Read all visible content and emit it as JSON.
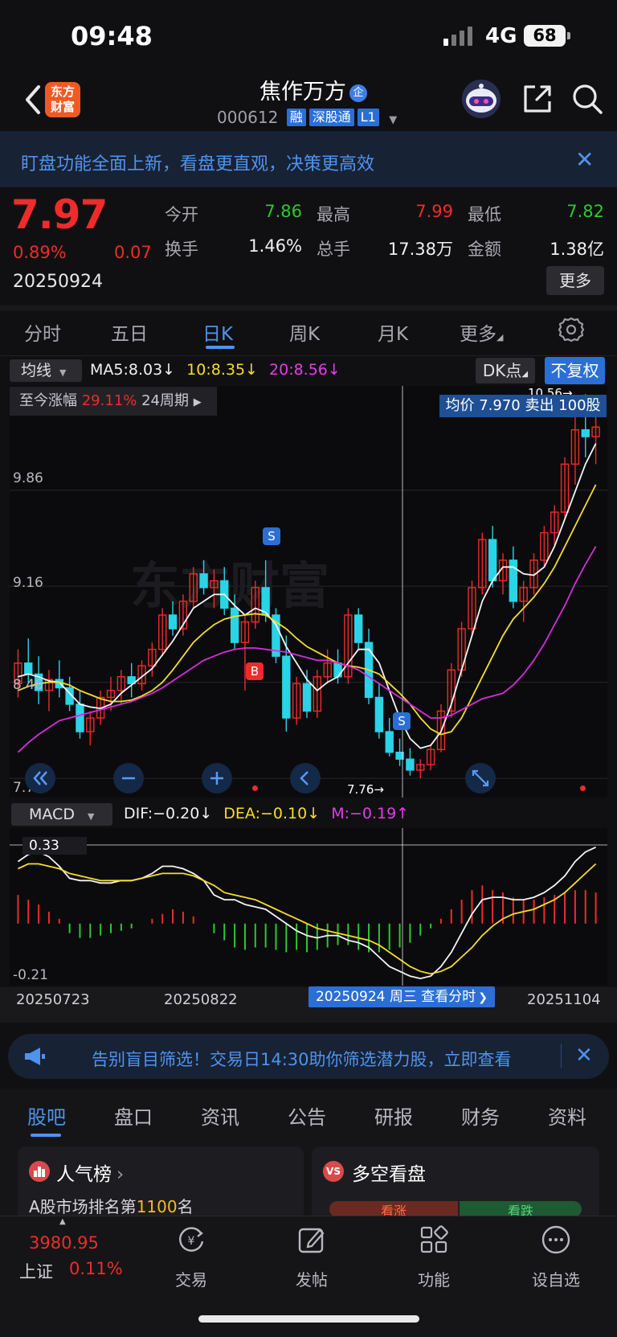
{
  "status_bar": {
    "time": "09:48",
    "network": "4G",
    "battery": "68"
  },
  "header": {
    "app_logo": "东方财富",
    "title": "焦作万方",
    "title_badge": "企",
    "code": "000612",
    "tags": [
      "融",
      "深股通",
      "L1"
    ],
    "icons": [
      "back-arrow-icon",
      "robot-avatar-icon",
      "share-icon",
      "search-icon"
    ]
  },
  "banner": {
    "text": "盯盘功能全面上新，看盘更直观，决策更高效",
    "close": "✕"
  },
  "quote": {
    "price": "7.97",
    "change_pct": "0.89%",
    "change": "0.07",
    "date": "20250924",
    "fields": [
      {
        "label": "今开",
        "value": "7.86",
        "color": "#2fc72f"
      },
      {
        "label": "最高",
        "value": "7.99",
        "color": "#ef2b2b"
      },
      {
        "label": "最低",
        "value": "7.82",
        "color": "#2fc72f"
      },
      {
        "label": "换手",
        "value": "1.46%",
        "color": "#f0f0f2"
      },
      {
        "label": "总手",
        "value": "17.38万",
        "color": "#f0f0f2"
      },
      {
        "label": "金额",
        "value": "1.38亿",
        "color": "#f0f0f2"
      }
    ],
    "more_button": "更多"
  },
  "chart_tabs": {
    "items": [
      "分时",
      "五日",
      "日K",
      "周K",
      "月K",
      "更多"
    ],
    "active": "日K"
  },
  "ma": {
    "selector": "均线",
    "ma5": "MA5:8.03↓",
    "ma10": "10:8.35↓",
    "ma20": "20:8.56↓",
    "dk_button": "DK点",
    "adjust_button": "不复权",
    "range_prefix": "至今涨幅",
    "range_pct": "29.11%",
    "range_period": "24周期",
    "avg_tooltip": "均价 7.970 卖出 100股"
  },
  "kline_axis": {
    "y_labels": [
      "9.86",
      "9.16",
      "8.46",
      "7.76"
    ],
    "high_marker": "10.56→",
    "low_marker": "7.76→"
  },
  "kline_controls": [
    "double-left-icon",
    "zoom-out-icon",
    "zoom-in-icon",
    "left-arrow-icon",
    "fullscreen-icon"
  ],
  "signals": {
    "buy": "B",
    "sell": "S"
  },
  "macd": {
    "selector": "MACD",
    "dif": "DIF:−0.20↓",
    "dea": "DEA:−0.10↓",
    "m": "M:−0.19↑",
    "y_top": "0.33",
    "y_bottom": "-0.21"
  },
  "date_axis": {
    "labels": [
      "20250723",
      "20250822",
      "20251104"
    ],
    "selected": "20250924 周三 查看分时"
  },
  "ad": {
    "text": "告别盲目筛选！交易日14:30助你筛选潜力股，立即查看",
    "close": "✕"
  },
  "bottom_tabs": {
    "items": [
      "股吧",
      "盘口",
      "资讯",
      "公告",
      "研报",
      "财务",
      "资料"
    ],
    "active": "股吧"
  },
  "cards": {
    "popular": {
      "title": "人气榜",
      "text_prefix": "A股市场排名第",
      "rank": "1100",
      "text_suffix": "名"
    },
    "bull_bear": {
      "title": "多空看盘",
      "bull": "看涨",
      "bear": "看跌"
    }
  },
  "bottom_nav": {
    "index_value": "3980.95",
    "index_name": "上证",
    "index_change": "0.11%",
    "items": [
      "交易",
      "发帖",
      "功能",
      "设自选"
    ]
  },
  "chart_data": [
    {
      "type": "candlestick",
      "title": "",
      "y_ticks": [
        9.86,
        9.16,
        8.46,
        7.76
      ],
      "ylim": [
        7.62,
        10.62
      ],
      "series_names": [
        "MA5",
        "MA10",
        "MA20"
      ],
      "ohlc": [
        [
          8.45,
          8.7,
          8.35,
          8.6
        ],
        [
          8.6,
          8.78,
          8.45,
          8.52
        ],
        [
          8.52,
          8.65,
          8.3,
          8.4
        ],
        [
          8.4,
          8.55,
          8.25,
          8.48
        ],
        [
          8.48,
          8.62,
          8.35,
          8.42
        ],
        [
          8.42,
          8.5,
          8.25,
          8.3
        ],
        [
          8.3,
          8.4,
          8.05,
          8.1
        ],
        [
          8.1,
          8.25,
          8.0,
          8.2
        ],
        [
          8.2,
          8.4,
          8.15,
          8.35
        ],
        [
          8.35,
          8.5,
          8.25,
          8.4
        ],
        [
          8.4,
          8.55,
          8.3,
          8.5
        ],
        [
          8.5,
          8.6,
          8.35,
          8.45
        ],
        [
          8.45,
          8.62,
          8.4,
          8.58
        ],
        [
          8.58,
          8.75,
          8.5,
          8.7
        ],
        [
          8.7,
          9.0,
          8.65,
          8.95
        ],
        [
          8.95,
          9.05,
          8.8,
          8.85
        ],
        [
          8.85,
          9.1,
          8.8,
          9.05
        ],
        [
          9.05,
          9.3,
          9.0,
          9.25
        ],
        [
          9.25,
          9.35,
          9.1,
          9.15
        ],
        [
          9.15,
          9.28,
          9.0,
          9.2
        ],
        [
          9.2,
          9.3,
          8.95,
          9.0
        ],
        [
          9.0,
          9.1,
          8.7,
          8.75
        ],
        [
          8.75,
          8.95,
          8.4,
          8.9
        ],
        [
          8.9,
          9.2,
          8.85,
          9.15
        ],
        [
          9.15,
          9.35,
          8.9,
          8.95
        ],
        [
          8.95,
          9.0,
          8.6,
          8.65
        ],
        [
          8.65,
          8.8,
          8.1,
          8.2
        ],
        [
          8.2,
          8.5,
          8.15,
          8.45
        ],
        [
          8.45,
          8.55,
          8.2,
          8.25
        ],
        [
          8.25,
          8.55,
          8.2,
          8.5
        ],
        [
          8.5,
          8.7,
          8.45,
          8.6
        ],
        [
          8.6,
          8.7,
          8.45,
          8.5
        ],
        [
          8.5,
          9.0,
          8.45,
          8.95
        ],
        [
          8.95,
          9.0,
          8.7,
          8.75
        ],
        [
          8.75,
          8.85,
          8.3,
          8.35
        ],
        [
          8.35,
          8.45,
          8.05,
          8.1
        ],
        [
          8.1,
          8.2,
          7.92,
          7.95
        ],
        [
          7.95,
          8.05,
          7.85,
          7.9
        ],
        [
          7.9,
          7.98,
          7.78,
          7.82
        ],
        [
          7.82,
          7.9,
          7.76,
          7.86
        ],
        [
          7.86,
          8.0,
          7.82,
          7.97
        ],
        [
          7.97,
          8.3,
          7.95,
          8.25
        ],
        [
          8.25,
          8.6,
          8.2,
          8.55
        ],
        [
          8.55,
          8.9,
          8.5,
          8.85
        ],
        [
          8.85,
          9.2,
          8.8,
          9.15
        ],
        [
          9.15,
          9.55,
          9.1,
          9.5
        ],
        [
          9.5,
          9.6,
          9.15,
          9.2
        ],
        [
          9.2,
          9.4,
          9.1,
          9.35
        ],
        [
          9.35,
          9.45,
          9.0,
          9.05
        ],
        [
          9.05,
          9.2,
          8.9,
          9.15
        ],
        [
          9.15,
          9.4,
          9.1,
          9.35
        ],
        [
          9.35,
          9.6,
          9.3,
          9.55
        ],
        [
          9.55,
          9.75,
          9.45,
          9.7
        ],
        [
          9.7,
          10.1,
          9.65,
          10.05
        ],
        [
          10.05,
          10.4,
          9.9,
          10.3
        ],
        [
          10.3,
          10.56,
          10.1,
          10.25
        ],
        [
          10.25,
          10.4,
          10.05,
          10.32
        ]
      ],
      "ma5": [
        8.5,
        8.52,
        8.5,
        8.47,
        8.46,
        8.38,
        8.3,
        8.28,
        8.27,
        8.3,
        8.38,
        8.44,
        8.5,
        8.56,
        8.66,
        8.76,
        8.88,
        9.0,
        9.05,
        9.1,
        9.1,
        9.02,
        8.95,
        9.0,
        8.97,
        8.88,
        8.72,
        8.6,
        8.48,
        8.4,
        8.46,
        8.5,
        8.6,
        8.7,
        8.7,
        8.6,
        8.4,
        8.2,
        8.05,
        7.98,
        8.0,
        8.1,
        8.3,
        8.55,
        8.8,
        9.05,
        9.2,
        9.3,
        9.3,
        9.25,
        9.24,
        9.3,
        9.45,
        9.65,
        9.85,
        10.05,
        10.2
      ],
      "ma10": [
        8.4,
        8.43,
        8.45,
        8.46,
        8.46,
        8.44,
        8.4,
        8.37,
        8.34,
        8.32,
        8.32,
        8.33,
        8.36,
        8.4,
        8.46,
        8.55,
        8.65,
        8.75,
        8.82,
        8.88,
        8.92,
        8.94,
        8.95,
        8.96,
        8.95,
        8.9,
        8.85,
        8.78,
        8.72,
        8.68,
        8.64,
        8.6,
        8.58,
        8.57,
        8.55,
        8.52,
        8.45,
        8.38,
        8.3,
        8.2,
        8.12,
        8.08,
        8.1,
        8.2,
        8.35,
        8.5,
        8.65,
        8.8,
        8.92,
        9.0,
        9.08,
        9.18,
        9.3,
        9.45,
        9.6,
        9.75,
        9.9
      ],
      "ma20": [
        7.95,
        8.02,
        8.08,
        8.13,
        8.18,
        8.2,
        8.22,
        8.24,
        8.26,
        8.28,
        8.3,
        8.32,
        8.35,
        8.38,
        8.42,
        8.47,
        8.52,
        8.57,
        8.62,
        8.65,
        8.68,
        8.7,
        8.71,
        8.71,
        8.7,
        8.69,
        8.68,
        8.66,
        8.64,
        8.62,
        8.62,
        8.6,
        8.58,
        8.55,
        8.5,
        8.45,
        8.4,
        8.35,
        8.3,
        8.25,
        8.2,
        8.2,
        8.22,
        8.26,
        8.3,
        8.34,
        8.36,
        8.38,
        8.44,
        8.52,
        8.62,
        8.74,
        8.88,
        9.02,
        9.18,
        9.32,
        9.45
      ]
    },
    {
      "type": "bar",
      "title": "",
      "series_names": [
        "DIF",
        "DEA",
        "MACD"
      ],
      "ylim": [
        -0.26,
        0.4
      ],
      "y_ticks": [
        0.33,
        -0.21
      ],
      "macd": [
        0.12,
        0.1,
        0.08,
        0.05,
        0.02,
        -0.04,
        -0.06,
        -0.06,
        -0.05,
        -0.04,
        -0.03,
        -0.02,
        0.0,
        0.02,
        0.04,
        0.06,
        0.05,
        0.03,
        0.0,
        -0.04,
        -0.07,
        -0.1,
        -0.11,
        -0.1,
        -0.1,
        -0.11,
        -0.12,
        -0.11,
        -0.12,
        -0.11,
        -0.1,
        -0.09,
        -0.09,
        -0.11,
        -0.12,
        -0.12,
        -0.11,
        -0.1,
        -0.08,
        -0.05,
        -0.02,
        0.02,
        0.06,
        0.1,
        0.14,
        0.16,
        0.14,
        0.13,
        0.11,
        0.1,
        0.1,
        0.11,
        0.12,
        0.13,
        0.14,
        0.14,
        0.13
      ],
      "dif": [
        0.26,
        0.29,
        0.3,
        0.28,
        0.24,
        0.19,
        0.18,
        0.18,
        0.17,
        0.17,
        0.18,
        0.18,
        0.19,
        0.21,
        0.24,
        0.24,
        0.23,
        0.21,
        0.18,
        0.12,
        0.1,
        0.1,
        0.08,
        0.07,
        0.06,
        0.03,
        0.0,
        -0.03,
        -0.05,
        -0.06,
        -0.05,
        -0.05,
        -0.07,
        -0.08,
        -0.1,
        -0.14,
        -0.18,
        -0.2,
        -0.22,
        -0.23,
        -0.22,
        -0.18,
        -0.12,
        -0.04,
        0.04,
        0.1,
        0.11,
        0.11,
        0.1,
        0.1,
        0.11,
        0.13,
        0.16,
        0.2,
        0.26,
        0.3,
        0.32
      ],
      "dea": [
        0.23,
        0.25,
        0.25,
        0.24,
        0.23,
        0.21,
        0.2,
        0.19,
        0.18,
        0.18,
        0.18,
        0.18,
        0.19,
        0.2,
        0.21,
        0.21,
        0.21,
        0.2,
        0.18,
        0.16,
        0.13,
        0.12,
        0.11,
        0.1,
        0.08,
        0.06,
        0.04,
        0.02,
        0.0,
        -0.02,
        -0.03,
        -0.04,
        -0.05,
        -0.06,
        -0.07,
        -0.09,
        -0.12,
        -0.15,
        -0.18,
        -0.2,
        -0.21,
        -0.2,
        -0.18,
        -0.14,
        -0.1,
        -0.05,
        -0.01,
        0.02,
        0.04,
        0.05,
        0.06,
        0.08,
        0.1,
        0.13,
        0.17,
        0.21,
        0.25
      ]
    }
  ]
}
